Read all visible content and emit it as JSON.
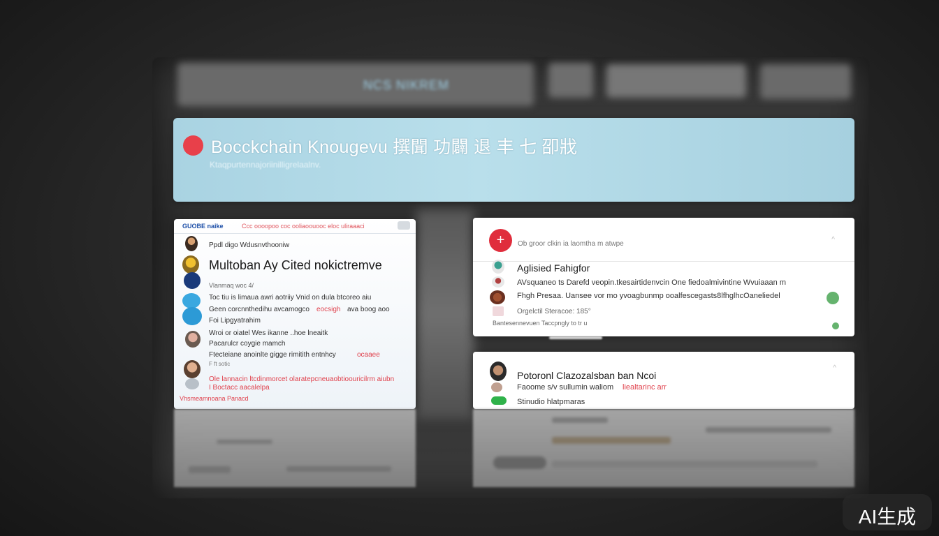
{
  "banner": {
    "title": "Bocckchain Knougevu 撰聞 功闢 退 丰 七   卲戕",
    "subtitle": "Ktaqpurtennajoriinilligrelaalnv."
  },
  "left_card": {
    "brand": "GUOBE naike",
    "nav": "Ccc oooopoo coc ooliaoouooc eloc uliraaaci",
    "rows": [
      {
        "text": "Ppdl digo Wdusnvthooniw"
      },
      {
        "text": "Multoban Ay Cited nokictremve"
      },
      {
        "text": "Vlanmaq woc 4/"
      },
      {
        "text": "Toc tiu is limaua awri aotriiy Vnid on dula btcoreo aiu"
      },
      {
        "text": "Geen corcnnthedihu avcamogco"
      },
      {
        "text": "eocsigh"
      },
      {
        "text": "ava boog aoo"
      },
      {
        "text": "Foi Lipgyatrahim"
      },
      {
        "text": "Wroi or oiatel Wes ikanne ..hoe lneaitk"
      },
      {
        "text": "Pacarulcr coygie mamch"
      },
      {
        "text": "Ftecteiane anoinlte gigge rimitith entnhcy"
      },
      {
        "text": "ocaaee"
      },
      {
        "text": "F ft sotic"
      },
      {
        "text": "Ole lannacin ltcdinmorcet olaratepcneuaobtioouricilrm aiubn"
      },
      {
        "text": "I Boctacc aacalelpa"
      },
      {
        "text": "Vhsmeamnoana Panacd"
      }
    ]
  },
  "right_card_1": {
    "meta": "Ob groor clkin ia laomtha m atwpe",
    "title": "Aglisied Fahigfor",
    "line1": "AVsquaneo ts Darefd veopin.tkesairtidenvcin One fiedoalmivintine Wvuiaaan m",
    "line2": "Fhgh Presaa. Uansee vor mo yvoagbunmp ooalfescegasts8lfhglhcOaneliedel",
    "line3": "Orgelctil Steracoe: 185°",
    "footer": "Bantesennevuen Taccpngly to tr u"
  },
  "right_card_2": {
    "title": "Potoronl Clazozalsban ban Ncoi",
    "line1": "Faoome s/v sullumin waliom",
    "line1_red": "liealtarinc arr",
    "line2": "Stinudio hlatpmaras"
  },
  "top_bar": {
    "center_text": "NCS NIKREM"
  },
  "watermark": {
    "text": "AI生成"
  },
  "colors": {
    "banner": "#b9dfeb",
    "accent_red": "#e02d3c",
    "brand_blue": "#1d4fa8",
    "toggle_green": "#2fb24a"
  }
}
